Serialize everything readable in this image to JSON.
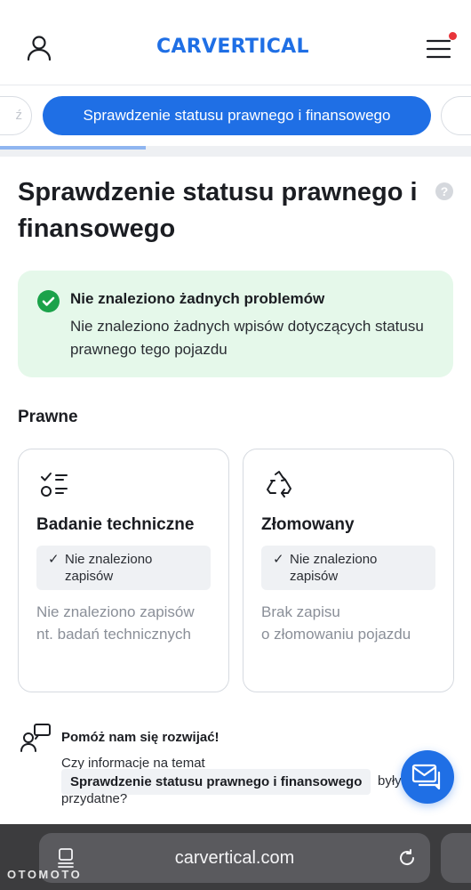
{
  "header": {
    "logo": "CARVERTICAL",
    "user_icon": "user-icon",
    "menu_icon": "hamburger-menu-icon",
    "notification_color": "#e8343a"
  },
  "tabs": {
    "active_label": "Sprawdzenie statusu prawnego i finansowego",
    "left_partial": "ź",
    "progress_fraction": 0.31
  },
  "page": {
    "title": "Sprawdzenie statusu prawnego i finansowego",
    "help_icon": "?"
  },
  "alert": {
    "title": "Nie znaleziono żadnych problemów",
    "text": "Nie znaleziono żadnych wpisów dotyczących statusu prawnego tego pojazdu",
    "color": "#1ba24a"
  },
  "section": {
    "label": "Prawne"
  },
  "cards": [
    {
      "icon": "checklist-icon",
      "title": "Badanie techniczne",
      "badge": "Nie znaleziono zapisów",
      "description_line1": "Nie znaleziono zapisów",
      "description_line2": "nt. badań technicznych"
    },
    {
      "icon": "recycle-icon",
      "title": "Złomowany",
      "badge": "Nie znaleziono zapisów",
      "description_line1": "Brak zapisu",
      "description_line2": "o złomowaniu pojazdu"
    }
  ],
  "feedback": {
    "title": "Pomóż nam się rozwijać!",
    "question_start": "Czy informacje na temat",
    "chip": "Sprawdzenie statusu prawnego i finansowego",
    "question_mid": "były",
    "question_end": "przydatne?"
  },
  "browser": {
    "url": "carvertical.com"
  },
  "watermark": "OTOMOTO",
  "colors": {
    "accent": "#1f6fe5",
    "success_bg": "#e5f8ea"
  }
}
